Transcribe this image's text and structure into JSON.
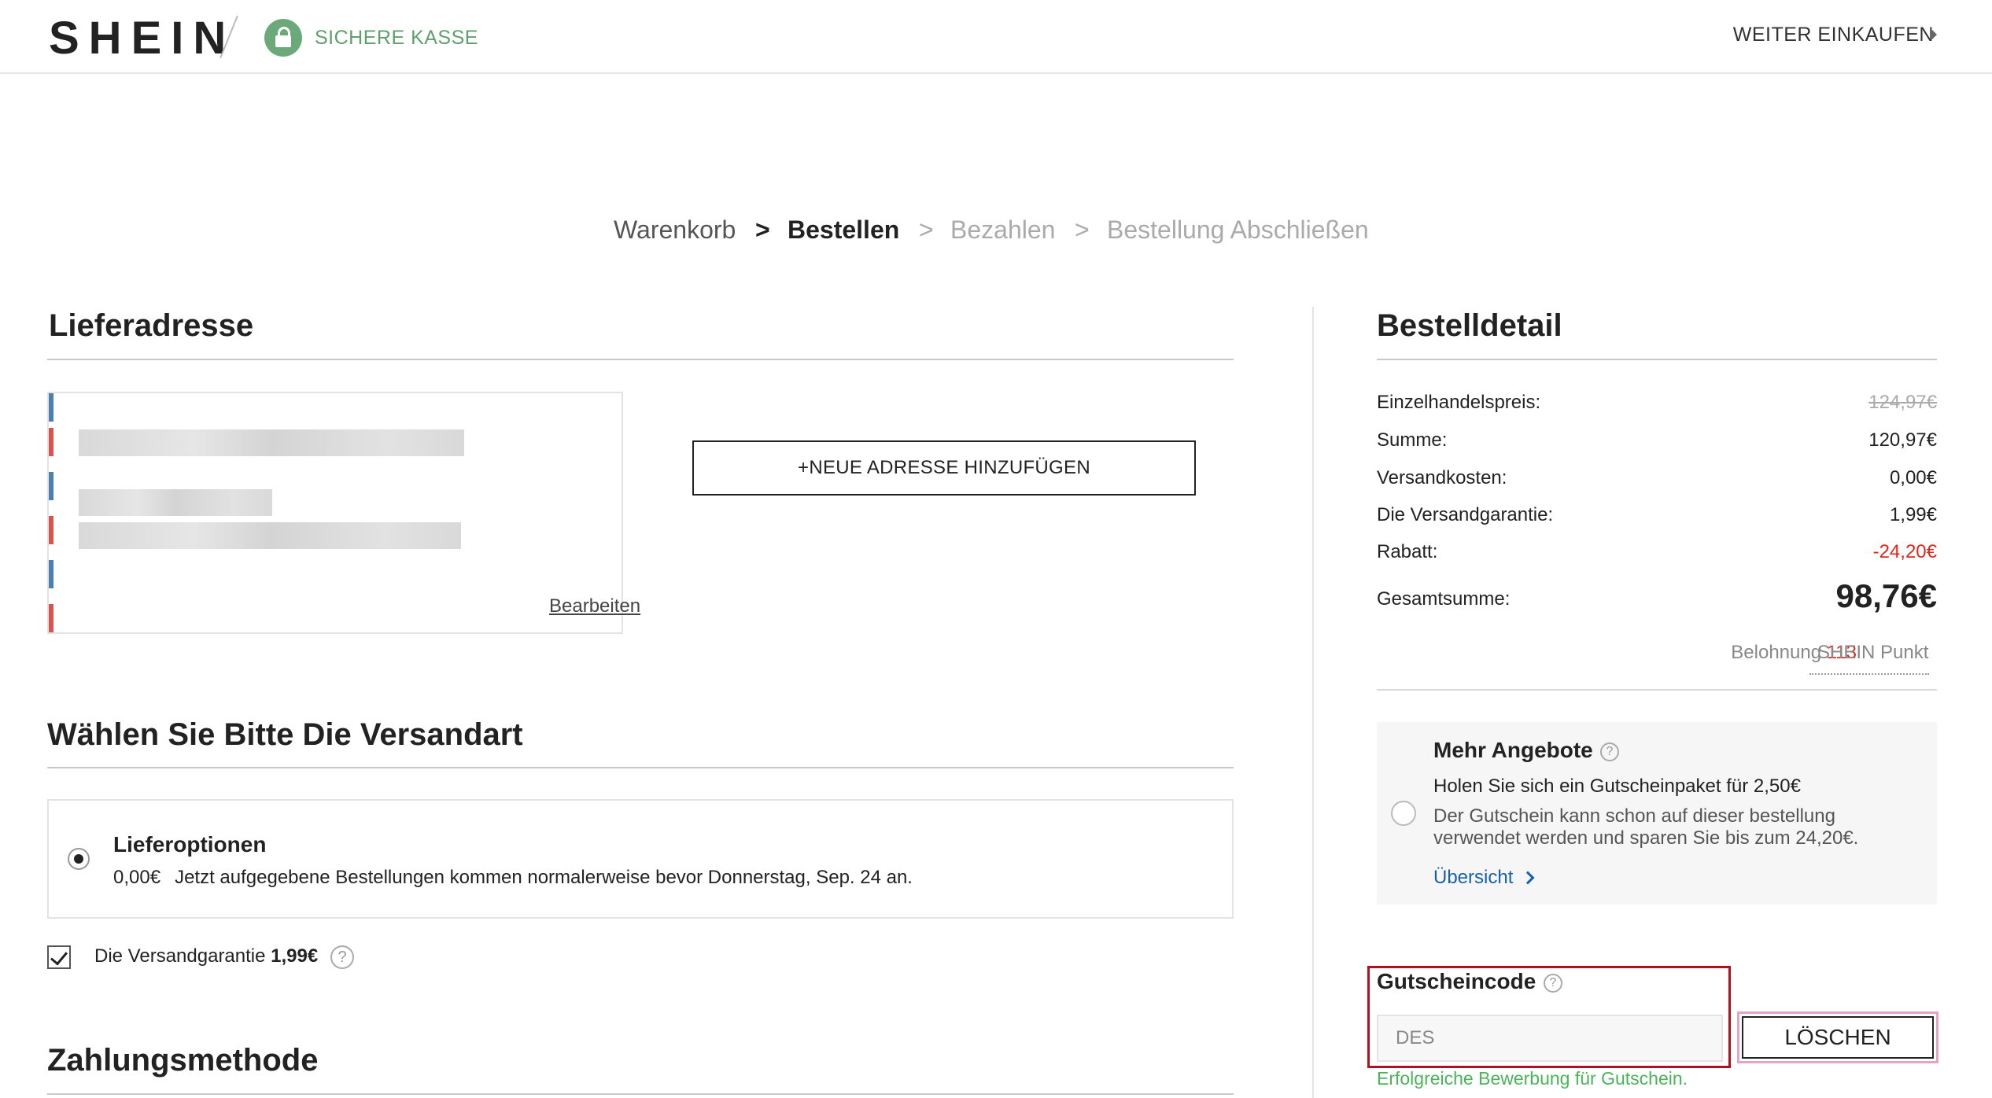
{
  "header": {
    "logo": "SHEIN",
    "secure_label": "SICHERE KASSE",
    "continue_shopping": "WEITER EINKAUFEN"
  },
  "breadcrumb": {
    "steps": [
      "Warenkorb",
      "Bestellen",
      "Bezahlen",
      "Bestellung Abschließen"
    ],
    "separator": ">",
    "active_step": "Bestellen"
  },
  "address": {
    "title": "Lieferadresse",
    "edit_label": "Bearbeiten",
    "add_button": "+NEUE ADRESSE HINZUFÜGEN"
  },
  "shipping": {
    "title": "Wählen Sie Bitte Die Versandart",
    "option_title": "Lieferoptionen",
    "option_price": "0,00€",
    "option_note": "Jetzt aufgegebene Bestellungen kommen normalerweise bevor Donnerstag, Sep. 24 an.",
    "guarantee_label": "Die Versandgarantie",
    "guarantee_price": "1,99€",
    "guarantee_checked": true
  },
  "payment": {
    "title": "Zahlungsmethode"
  },
  "order_detail": {
    "title": "Bestelldetail",
    "rows": [
      {
        "label": "Einzelhandelspreis:",
        "value": "124,97€"
      },
      {
        "label": "Summe:",
        "value": "120,97€"
      },
      {
        "label": "Versandkosten:",
        "value": "0,00€"
      },
      {
        "label": "Die Versandgarantie:",
        "value": "1,99€"
      },
      {
        "label": "Rabatt:",
        "value": "-24,20€"
      }
    ],
    "total_label": "Gesamtsumme:",
    "total_value": "98,76€",
    "reward_label": "Belohnung",
    "reward_points": "113",
    "reward_unit": "SHEIN Punkt"
  },
  "offers": {
    "title": "Mehr Angebote",
    "headline": "Holen Sie sich ein Gutscheinpaket für 2,50€",
    "description": "Der Gutschein kann schon auf dieser bestellung verwendet werden und sparen Sie bis zum 24,20€.",
    "link": "Übersicht"
  },
  "coupon": {
    "label": "Gutscheincode",
    "value": "DES",
    "delete_button": "LÖSCHEN",
    "success_message": "Erfolgreiche Bewerbung für Gutschein."
  },
  "colors": {
    "secure_green": "#5f9f6e",
    "discount_red": "#e1251b",
    "link_blue": "#1860a8",
    "success_green": "#4bb35a",
    "highlight_frame": "#b2101f"
  }
}
